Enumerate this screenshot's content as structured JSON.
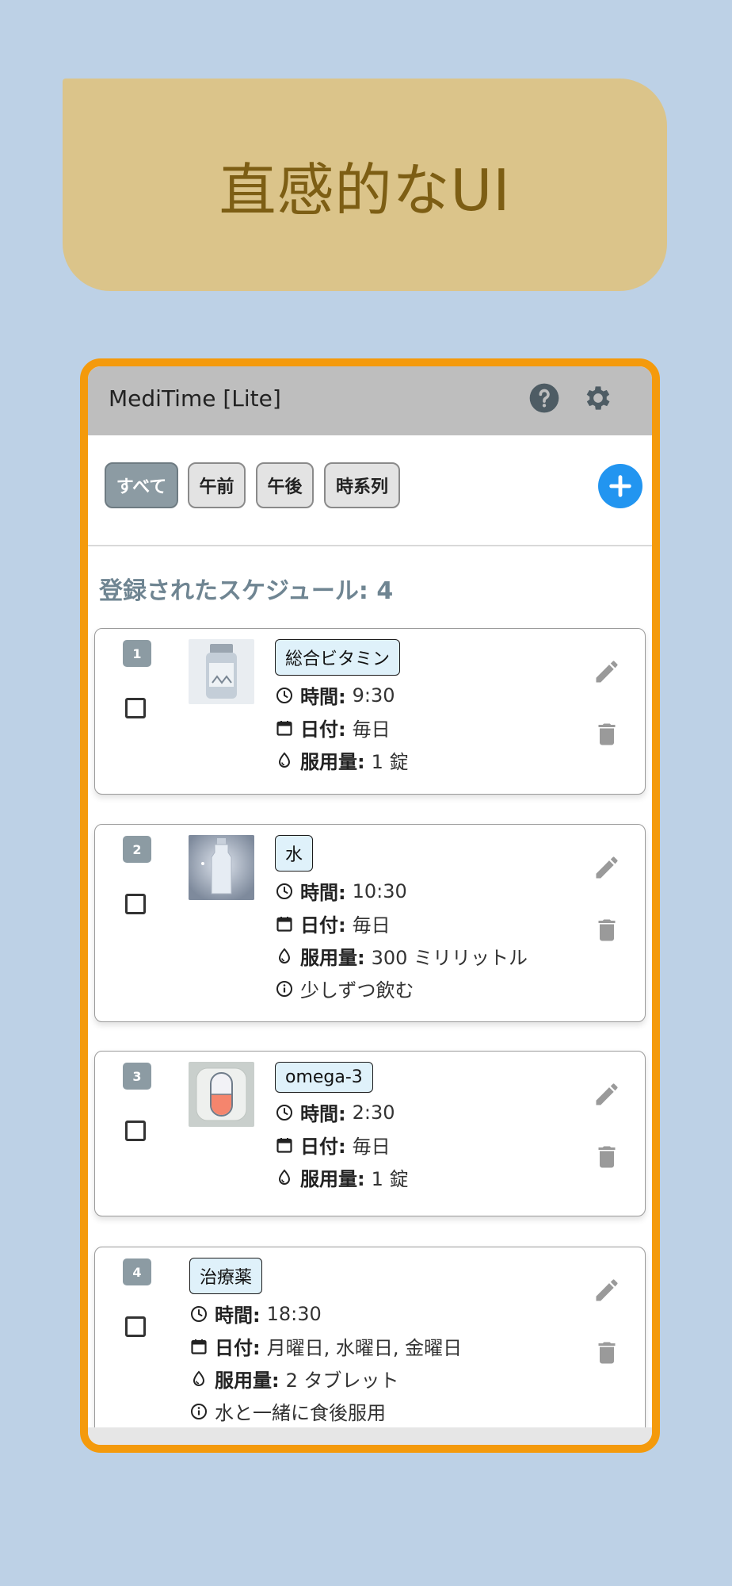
{
  "banner": {
    "text": "直感的なUI"
  },
  "app": {
    "title": "MediTime [Lite]",
    "icons": {
      "help": "help-circle-icon",
      "settings": "gear-icon",
      "add": "plus-icon"
    }
  },
  "filters": [
    {
      "label": "すべて",
      "active": true
    },
    {
      "label": "午前",
      "active": false
    },
    {
      "label": "午後",
      "active": false
    },
    {
      "label": "時系列",
      "active": false
    }
  ],
  "summary": {
    "text": "登録されたスケジュール: 4"
  },
  "labels": {
    "time": "時間:",
    "date": "日付:",
    "dose": "服用量:"
  },
  "schedules": [
    {
      "number": "1",
      "name": "総合ビタミン",
      "image": "vitamin-bottle-image",
      "time": "9:30",
      "date": "毎日",
      "dose": "1 錠",
      "note": ""
    },
    {
      "number": "2",
      "name": "水",
      "image": "water-bottle-image",
      "time": "10:30",
      "date": "毎日",
      "dose": "300 ミリリットル",
      "note": "少しずつ飲む"
    },
    {
      "number": "3",
      "name": "omega-3",
      "image": "capsule-image",
      "time": "2:30",
      "date": "毎日",
      "dose": "1 錠",
      "note": ""
    },
    {
      "number": "4",
      "name": "治療薬",
      "image": "",
      "time": "18:30",
      "date": "月曜日, 水曜日, 金曜日",
      "dose": "2 タブレット",
      "note": "水と一緒に食後服用"
    }
  ],
  "colors": {
    "accent_border": "#f49a0c",
    "add_button": "#2295f0",
    "badge": "#8c9ba3",
    "tag_bg": "#dff1fa"
  }
}
